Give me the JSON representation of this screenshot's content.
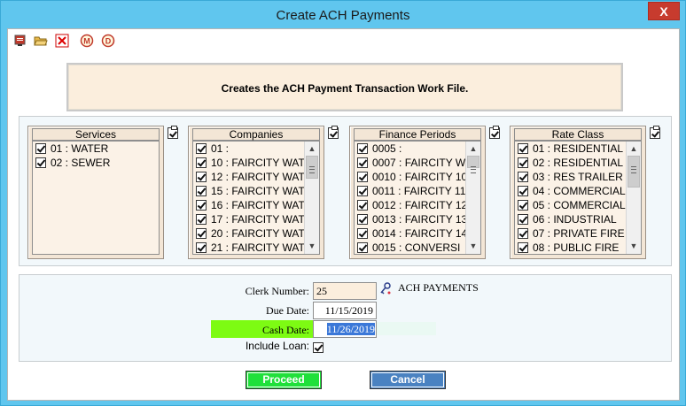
{
  "window": {
    "title": "Create ACH Payments",
    "close_label": "X"
  },
  "toolbar": {
    "icons": [
      "report-icon",
      "open-folder-icon",
      "close-red-x-icon",
      "m-circle-icon",
      "d-circle-icon"
    ],
    "m_label": "M",
    "d_label": "D"
  },
  "banner": {
    "text": "Creates the ACH Payment Transaction Work File."
  },
  "lists": {
    "services": {
      "title": "Services",
      "items": [
        {
          "label": "01 : WATER",
          "checked": true
        },
        {
          "label": "02 : SEWER",
          "checked": true
        }
      ]
    },
    "companies": {
      "title": "Companies",
      "items": [
        {
          "label": "01 :",
          "checked": true
        },
        {
          "label": "10 : FAIRCITY WAT",
          "checked": true
        },
        {
          "label": "12 : FAIRCITY WAT",
          "checked": true
        },
        {
          "label": "15 : FAIRCITY WAT",
          "checked": true
        },
        {
          "label": "16 : FAIRCITY WAT",
          "checked": true
        },
        {
          "label": "17 : FAIRCITY WAT",
          "checked": true
        },
        {
          "label": "20 : FAIRCITY WAT",
          "checked": true
        },
        {
          "label": "21 : FAIRCITY WAT",
          "checked": true
        }
      ]
    },
    "finance_periods": {
      "title": "Finance Periods",
      "items": [
        {
          "label": "0005 :",
          "checked": true
        },
        {
          "label": "0007 : FAIRCITY W",
          "checked": true
        },
        {
          "label": "0010 : FAIRCITY 10",
          "checked": true
        },
        {
          "label": "0011 : FAIRCITY 11",
          "checked": true
        },
        {
          "label": "0012 : FAIRCITY 12",
          "checked": true
        },
        {
          "label": "0013 : FAIRCITY 13",
          "checked": true
        },
        {
          "label": "0014 : FAIRCITY 14",
          "checked": true
        },
        {
          "label": "0015 : CONVERSI",
          "checked": true
        }
      ]
    },
    "rate_class": {
      "title": "Rate Class",
      "items": [
        {
          "label": "01 : RESIDENTIAL",
          "checked": true
        },
        {
          "label": "02 : RESIDENTIAL",
          "checked": true
        },
        {
          "label": "03 : RES TRAILER",
          "checked": true
        },
        {
          "label": "04 : COMMERCIAL",
          "checked": true
        },
        {
          "label": "05 : COMMERCIAL",
          "checked": true
        },
        {
          "label": "06 : INDUSTRIAL",
          "checked": true
        },
        {
          "label": "07 : PRIVATE FIRE",
          "checked": true
        },
        {
          "label": "08 : PUBLIC FIRE",
          "checked": true
        }
      ]
    }
  },
  "form": {
    "clerk_number_label": "Clerk Number:",
    "clerk_number_value": "25",
    "clerk_description": "ACH PAYMENTS",
    "due_date_label": "Due Date:",
    "due_date_value": "11/15/2019",
    "cash_date_label": "Cash Date:",
    "cash_date_value": "11/26/2019",
    "include_loan_label": "Include Loan:",
    "include_loan_checked": true
  },
  "buttons": {
    "proceed": "Proceed",
    "cancel": "Cancel"
  },
  "colors": {
    "window_frame": "#60c6ee",
    "banner_bg": "#fbeedd",
    "list_bg": "#f3e6d6",
    "cash_date_highlight": "#7dfb13",
    "proceed_bg": "#1fe03a",
    "cancel_bg": "#4a82c1",
    "selection": "#3b78d8"
  }
}
